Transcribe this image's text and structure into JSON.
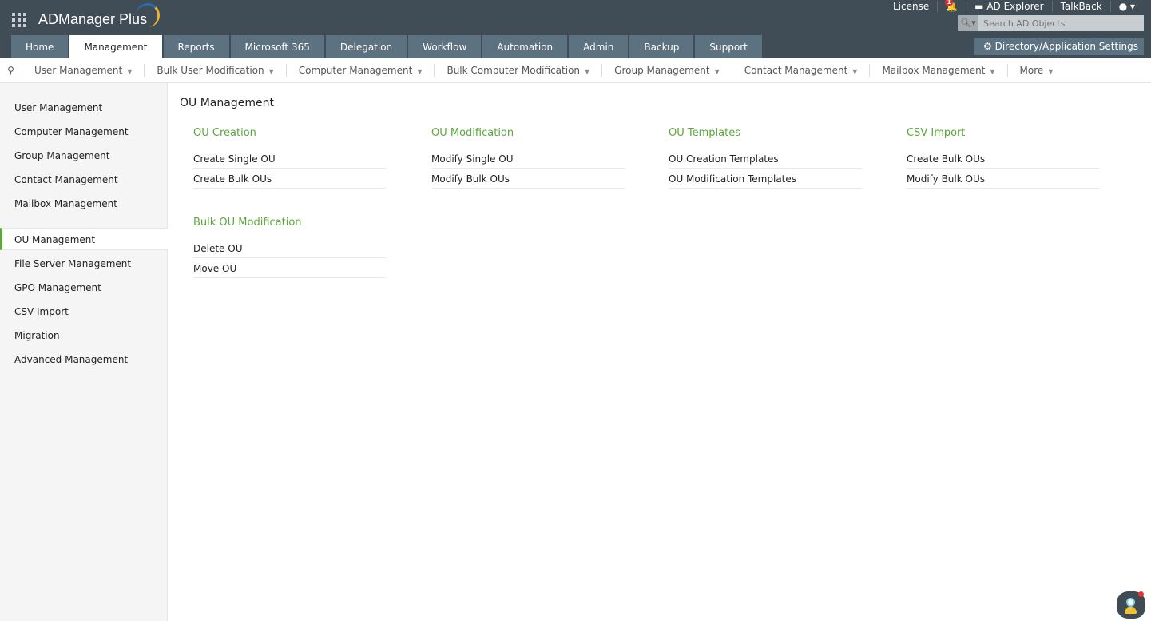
{
  "app": {
    "title": "ADManager Plus"
  },
  "tabs": [
    "Home",
    "Management",
    "Reports",
    "Microsoft 365",
    "Delegation",
    "Workflow",
    "Automation",
    "Admin",
    "Backup",
    "Support"
  ],
  "top_links": {
    "license": "License",
    "notifications": "1",
    "ad_explorer": "AD Explorer",
    "talkback": "TalkBack"
  },
  "search": {
    "placeholder": "Search AD Objects"
  },
  "settings_label": "Directory/Application Settings",
  "subnav": [
    "User Management",
    "Bulk User Modification",
    "Computer Management",
    "Bulk Computer Modification",
    "Group Management",
    "Contact Management",
    "Mailbox Management",
    "More"
  ],
  "sidebar": [
    "User Management",
    "Computer Management",
    "Group Management",
    "Contact Management",
    "Mailbox Management",
    "OU Management",
    "File Server Management",
    "GPO Management",
    "CSV Import",
    "Migration",
    "Advanced Management"
  ],
  "page_title": "OU Management",
  "sections": [
    {
      "title": "OU Creation",
      "links": [
        "Create Single OU",
        "Create Bulk OUs"
      ]
    },
    {
      "title": "OU Modification",
      "links": [
        "Modify Single OU",
        "Modify Bulk OUs"
      ]
    },
    {
      "title": "OU Templates",
      "links": [
        "OU Creation Templates",
        "OU Modification Templates"
      ]
    },
    {
      "title": "CSV Import",
      "links": [
        "Create Bulk OUs",
        "Modify Bulk OUs"
      ]
    },
    {
      "title": "Bulk OU Modification",
      "links": [
        "Delete OU",
        "Move OU"
      ]
    }
  ],
  "colors": {
    "header": "#414d56",
    "tab": "#5d7280",
    "accent": "#5aa83a"
  }
}
